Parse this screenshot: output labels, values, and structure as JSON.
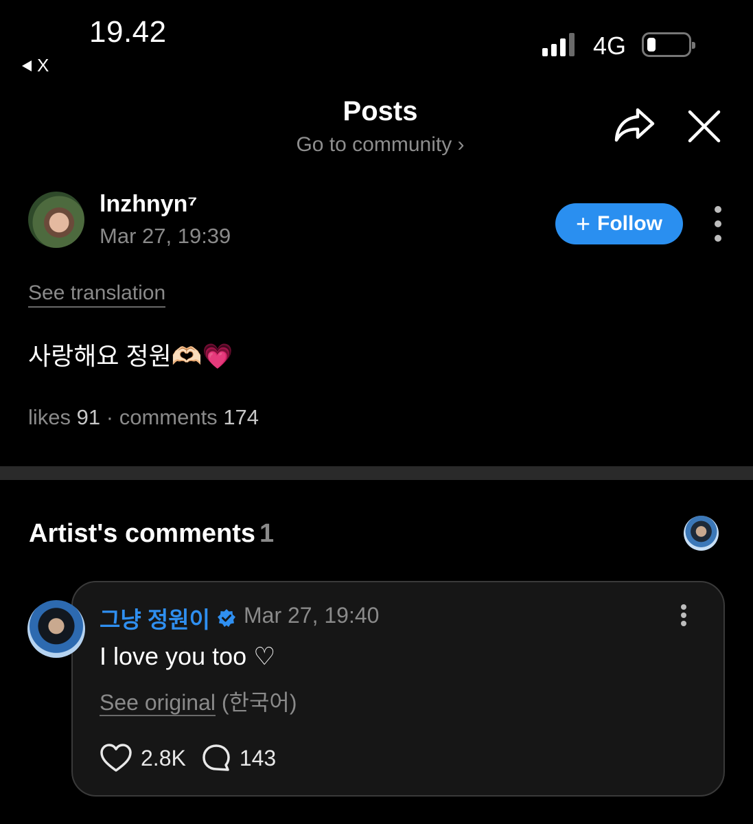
{
  "status_bar": {
    "time": "19.42",
    "back_app": "X",
    "network": "4G"
  },
  "header": {
    "title": "Posts",
    "subtitle": "Go to community ›"
  },
  "post": {
    "author": "lnzhnyn⁷",
    "date": "Mar 27, 19:39",
    "follow_label": "Follow",
    "see_translation": "See translation",
    "body": "사랑해요 정원🫶🏻💗",
    "likes_label": "likes",
    "likes": "91",
    "sep": "·",
    "comments_label": "comments",
    "comments": "174"
  },
  "artist_comments": {
    "title": "Artist's comments",
    "count": "1",
    "comment": {
      "author": "그냥 정원이",
      "date": "Mar 27, 19:40",
      "text": "I love you too ♡",
      "see_original": "See original",
      "language": "(한국어)",
      "likes": "2.8K",
      "replies": "143"
    }
  },
  "colors": {
    "accent": "#2a8ff0",
    "background": "#000000",
    "card": "#161616",
    "muted": "#8a8a8a"
  }
}
